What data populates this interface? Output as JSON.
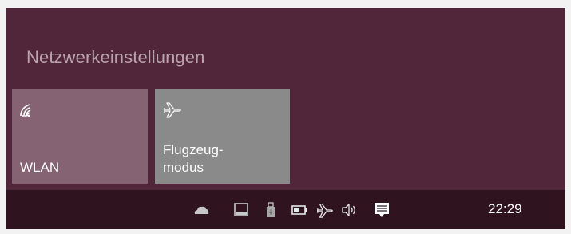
{
  "flyout": {
    "title": "Netzwerkeinstellungen",
    "tiles": [
      {
        "label": "WLAN",
        "icon": "wifi-icon",
        "state": "on"
      },
      {
        "label": "Flugzeug-\nmodus",
        "icon": "airplane-icon",
        "state": "off"
      }
    ]
  },
  "taskbar": {
    "tray_icons": [
      "onedrive-cloud-icon",
      "touch-keyboard-icon",
      "usb-device-icon",
      "battery-icon",
      "airplane-mode-icon",
      "speaker-volume-icon",
      "action-center-icon"
    ],
    "clock": "22:29"
  },
  "colors": {
    "flyout_bg": "#52263a",
    "taskbar_bg": "#2f1420",
    "wifi_tile_bg": "#866373",
    "airplane_tile_bg": "#8a8a8a",
    "header_text": "#b9a3ad"
  }
}
